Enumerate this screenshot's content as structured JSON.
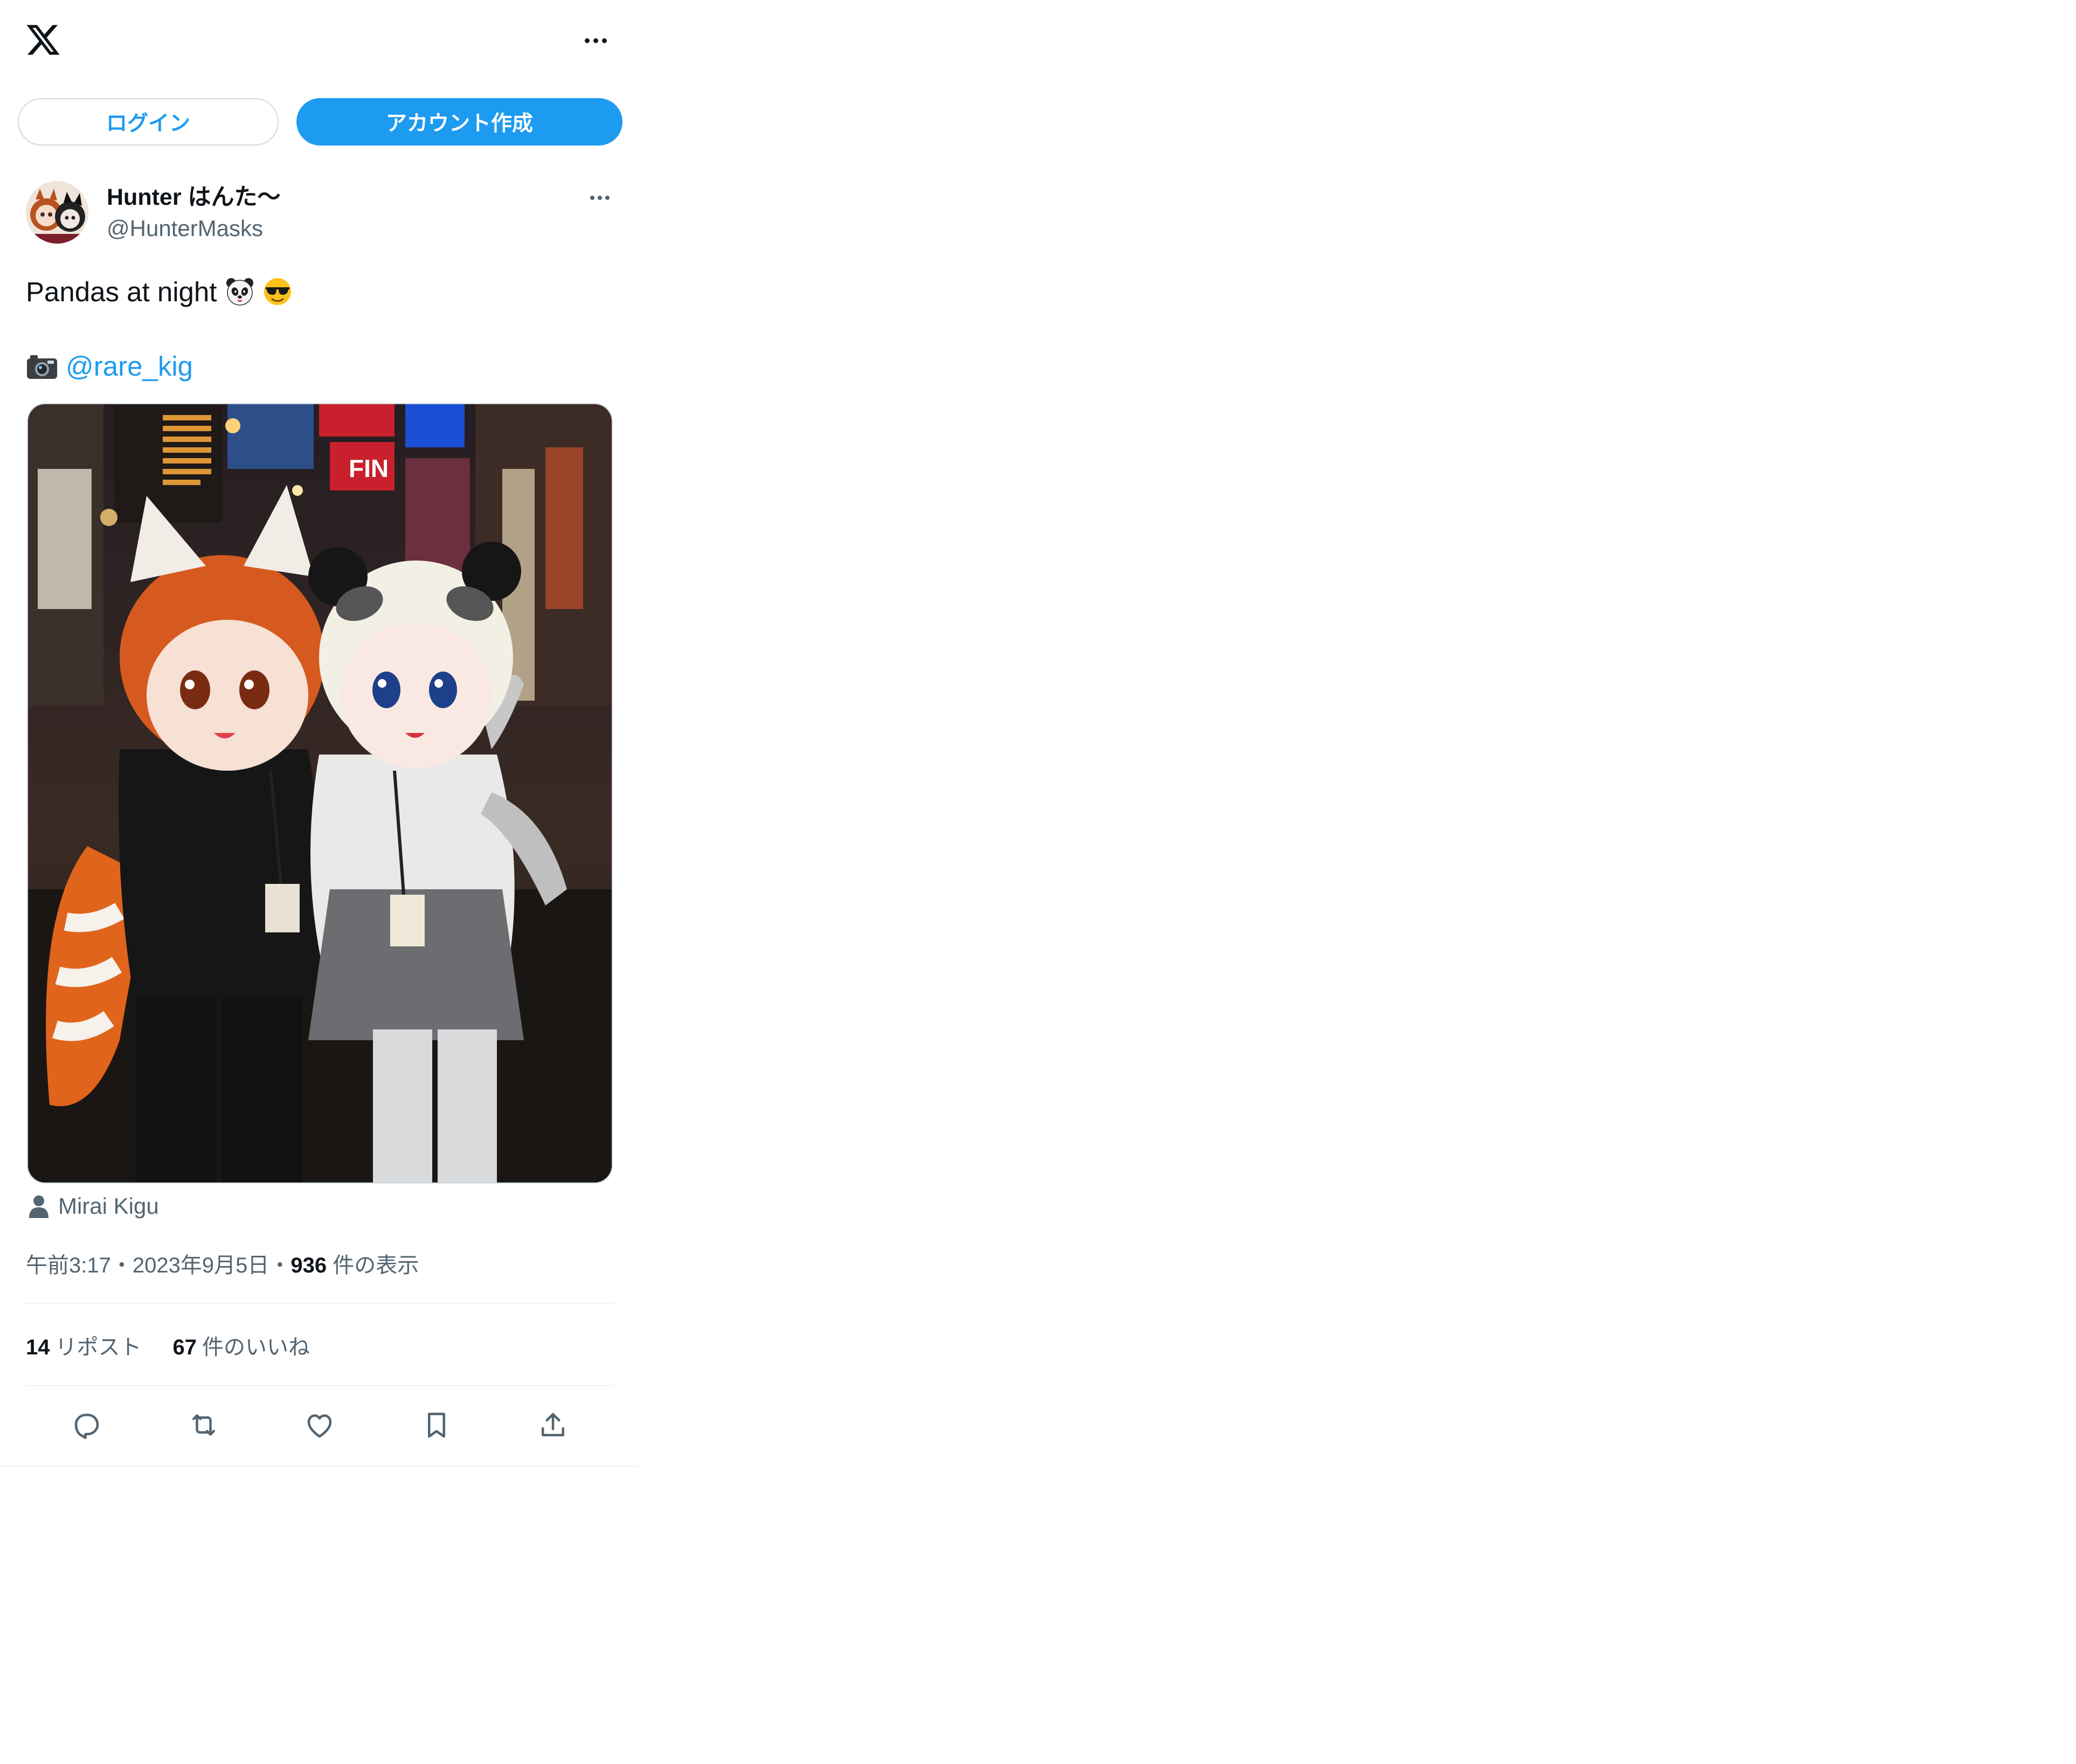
{
  "header": {
    "logo_icon": "x-logo-icon",
    "more_icon": "more-horizontal-icon"
  },
  "auth": {
    "login_label": "ログイン",
    "signup_label": "アカウント作成",
    "accent_color": "#1d9bf0"
  },
  "tweet": {
    "author_name": "Hunter はんた〜",
    "author_handle": "@HunterMasks",
    "text": "Pandas at night",
    "text_emojis": [
      "panda-face-emoji",
      "smiling-face-with-sunglasses-emoji"
    ],
    "credit_icon": "camera-with-flash-emoji",
    "credit_mention": "@rare_kig",
    "media_tag": "Mirai Kigu",
    "time": "午前3:17",
    "separator": "・",
    "date": "2023年9月5日",
    "views_count": "936",
    "views_label": "件の表示",
    "reposts_count": "14",
    "reposts_label": "リポスト",
    "likes_count": "67",
    "likes_label": "件のいいね"
  },
  "actions": {
    "reply_icon": "reply-icon",
    "repost_icon": "repost-icon",
    "like_icon": "heart-icon",
    "bookmark_icon": "bookmark-icon",
    "share_icon": "share-icon"
  }
}
